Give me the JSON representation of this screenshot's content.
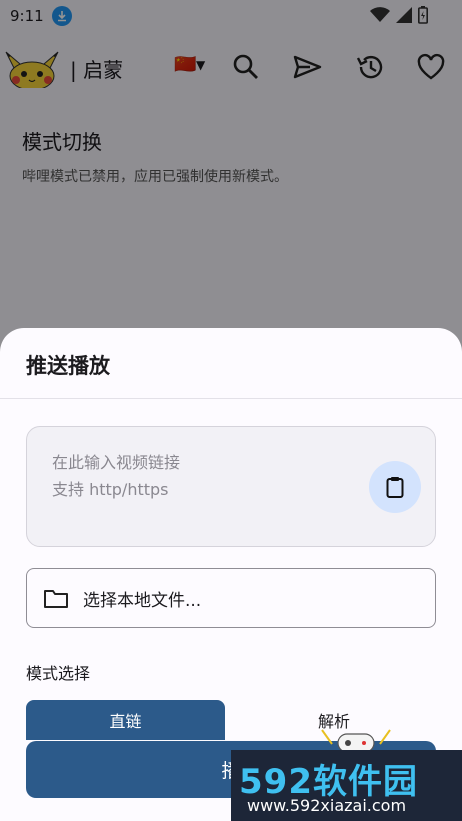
{
  "status_bar": {
    "time": "9:11"
  },
  "app_bar": {
    "title": "| 启蒙",
    "language_flag": "🇨🇳"
  },
  "page": {
    "section_title": "模式切换",
    "section_desc": "哔哩模式已禁用，应用已强制使用新模式。"
  },
  "sheet": {
    "title": "推送播放",
    "url_placeholder": "在此输入视频链接\n支持 http/https",
    "file_picker_label": "选择本地文件...",
    "mode_label": "模式选择",
    "mode_direct": "直链",
    "mode_parse": "解析",
    "play_label": "播"
  },
  "watermark": {
    "main": "592软件园",
    "url": "www.592xiazai.com"
  },
  "colors": {
    "primary": "#2c5a8a",
    "paste_button_bg": "#d3e3fd",
    "scrim": "rgba(0,0,0,0.42)",
    "download_badge": "#2196f3",
    "watermark_bg": "#1d2638",
    "watermark_text": "#3fc0f0"
  },
  "icons": [
    "download-icon",
    "wifi-icon",
    "signal-icon",
    "battery-icon",
    "pikachu-logo",
    "search-icon",
    "send-icon",
    "history-icon",
    "heart-icon",
    "clipboard-icon",
    "folder-icon"
  ]
}
